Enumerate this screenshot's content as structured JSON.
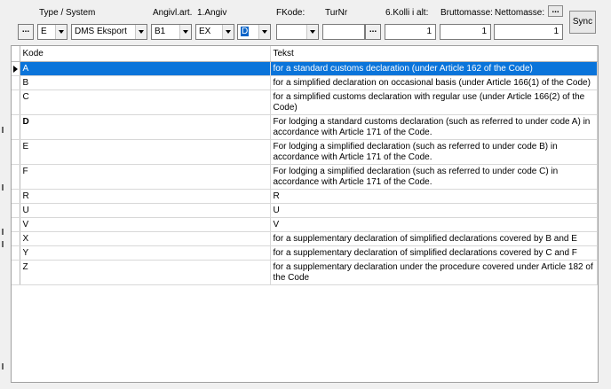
{
  "toolbar": {
    "labels": {
      "type_system": "Type / System",
      "angivl_art": "Angivl.art.",
      "angiv1": "1.Angiv",
      "fkode": "FKode:",
      "turnr": "TurNr",
      "kolli": "6.Kolli i alt:",
      "brutto": "Bruttomasse:",
      "netto": "Nettomasse:"
    },
    "dots_label": "...",
    "type_value": "E",
    "system_value": "DMS Eksport",
    "angivl_art_value": "B1",
    "angiv1_value": "EX",
    "angiv2_value": "D",
    "fkode_value": "",
    "turnr_value": "",
    "kolli_value": "1",
    "brutto_value": "1",
    "netto_value": "1",
    "sync_label": "Sync"
  },
  "grid": {
    "columns": [
      "Kode",
      "Tekst"
    ],
    "rows": [
      {
        "kode": "A",
        "tekst": "for a standard customs declaration (under Article 162 of the Code)"
      },
      {
        "kode": "B",
        "tekst": "for a simplified declaration on occasional basis (under Article 166(1) of the Code)"
      },
      {
        "kode": "C",
        "tekst": "for a simplified customs declaration with regular use (under Article 166(2) of the Code)"
      },
      {
        "kode": "D",
        "tekst": "For lodging a standard customs declaration (such as referred to under code A) in accordance with Article 171 of the Code."
      },
      {
        "kode": "E",
        "tekst": "For lodging a simplified declaration (such as referred to under code B) in accordance with Article 171 of the Code."
      },
      {
        "kode": "F",
        "tekst": "For lodging a simplified declaration (such as referred to under code C) in accordance with Article 171 of the Code."
      },
      {
        "kode": "R",
        "tekst": "R"
      },
      {
        "kode": "U",
        "tekst": "U"
      },
      {
        "kode": "V",
        "tekst": "V"
      },
      {
        "kode": "X",
        "tekst": "for a supplementary declaration of simplified declarations covered by B and E"
      },
      {
        "kode": "Y",
        "tekst": "for a supplementary declaration of simplified declarations covered by C and F"
      },
      {
        "kode": "Z",
        "tekst": "for a supplementary declaration under the procedure covered under Article 182 of the Code"
      }
    ]
  },
  "colors": {
    "selection": "#0a74da",
    "window_bg": "#f0f0f0"
  }
}
